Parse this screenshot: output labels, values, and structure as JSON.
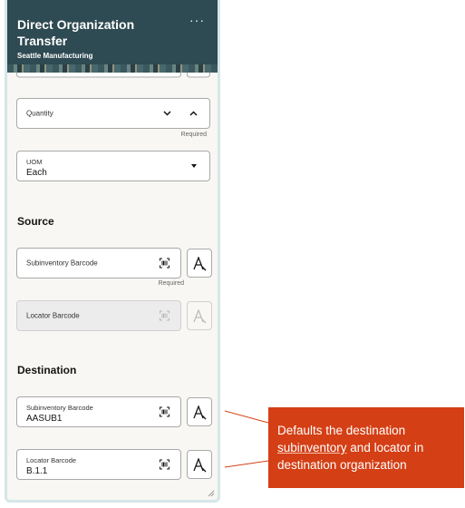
{
  "header": {
    "title": "Direct Organization Transfer",
    "subtitle": "Seattle Manufacturing",
    "more": "···"
  },
  "quantity": {
    "label": "Quantity",
    "required": "Required"
  },
  "uom": {
    "label": "UOM",
    "value": "Each"
  },
  "source": {
    "heading": "Source",
    "subinventory_label": "Subinventory Barcode",
    "subinventory_required": "Required",
    "locator_label": "Locator Barcode"
  },
  "destination": {
    "heading": "Destination",
    "subinventory_label": "Subinventory Barcode",
    "subinventory_value": "AASUB1",
    "locator_label": "Locator Barcode",
    "locator_value": "B.1.1"
  },
  "callout": {
    "text_before": "Defaults the destination ",
    "text_underlined": "subinventory",
    "text_after": " and locator in destination organization"
  },
  "colors": {
    "header_bg": "#2e4a52",
    "callout_bg": "#d43f15"
  }
}
